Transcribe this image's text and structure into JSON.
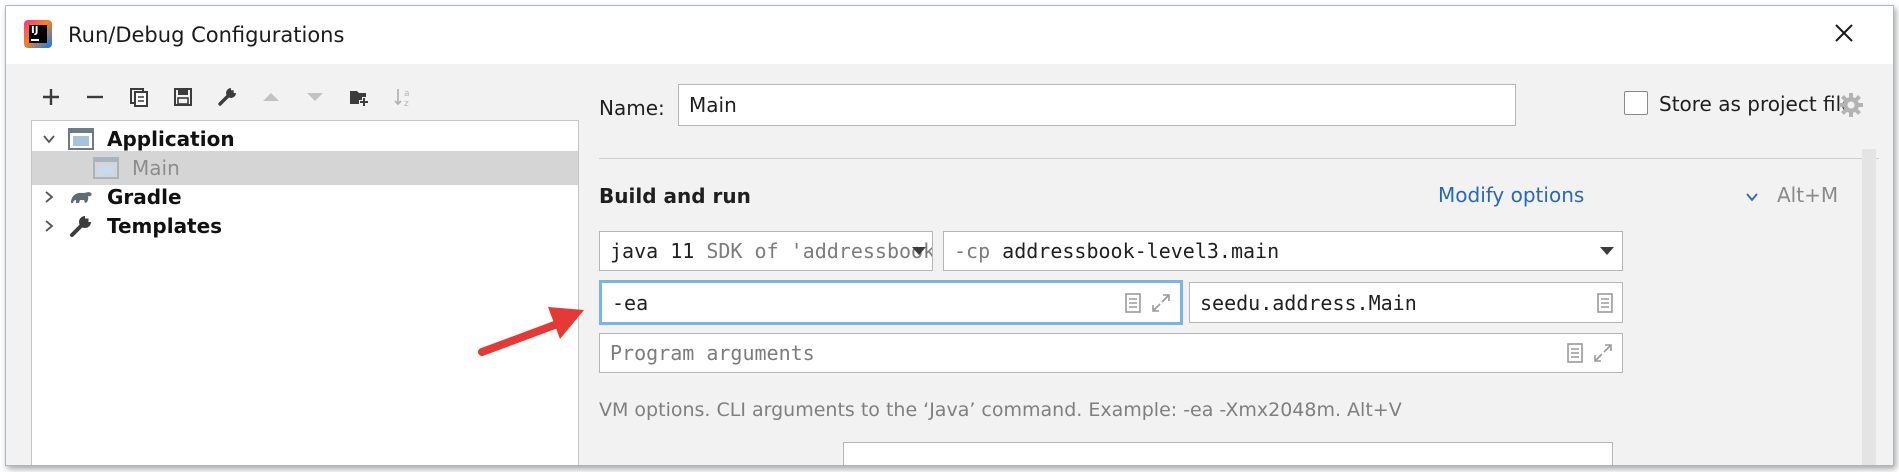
{
  "window": {
    "title": "Run/Debug Configurations",
    "app_icon_text": "IJ"
  },
  "toolbar": {
    "icons": [
      "add-icon",
      "remove-icon",
      "copy-icon",
      "save-icon",
      "wrench-icon",
      "move-up-icon",
      "move-down-icon",
      "new-folder-icon",
      "sort-icon"
    ]
  },
  "tree": {
    "items": [
      {
        "label": "Application",
        "expanded": true,
        "icon": "application-icon"
      },
      {
        "label": "Main",
        "selected": true,
        "icon": "application-icon"
      },
      {
        "label": "Gradle",
        "expanded": false,
        "icon": "gradle-icon"
      },
      {
        "label": "Templates",
        "expanded": false,
        "icon": "wrench-icon"
      }
    ]
  },
  "form": {
    "name_label": "Name:",
    "name_value": "Main",
    "store_label": "Store as project file",
    "store_checked": false,
    "section_title": "Build and run",
    "modify_options": "Modify options",
    "modify_shortcut": "Alt+M",
    "jdk": {
      "main": "java 11",
      "detail": "SDK of 'addressbook"
    },
    "classpath": {
      "prefix": "-cp",
      "value": "addressbook-level3.main"
    },
    "vm_options_value": "-ea",
    "main_class_value": "seedu.address.Main",
    "program_args_placeholder": "Program arguments",
    "hint": "VM options. CLI arguments to the ‘Java’ command. Example: -ea -Xmx2048m. Alt+V"
  },
  "colors": {
    "accent_link": "#2769b7",
    "focus_border": "#7ab3e6",
    "arrow": "#e53935",
    "selection": "#d5d5d5"
  }
}
